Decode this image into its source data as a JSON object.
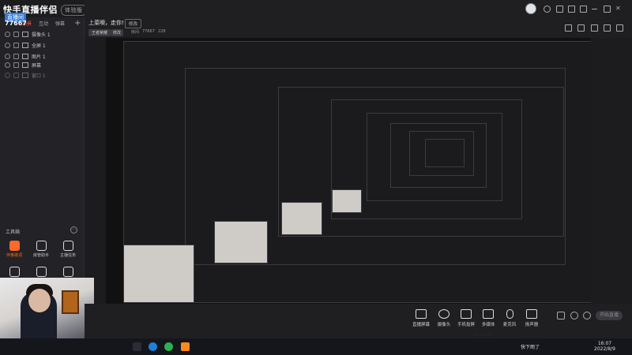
{
  "app": {
    "logo_text": "快手直播伴侣",
    "version_badge": "体验版",
    "biz_badge": "直播间",
    "room_number": "77667"
  },
  "scene_tabs": [
    "场景",
    "互动",
    "弹幕"
  ],
  "sources": [
    {
      "label": "摄像头 1"
    },
    {
      "label": "全屏 1"
    },
    {
      "label": "图片 1"
    },
    {
      "label": "屏幕"
    },
    {
      "label": "窗口 1"
    }
  ],
  "toolbox": {
    "title": "工具箱",
    "more": "···",
    "tools": [
      "伴奏歌词",
      "房管助手",
      "主播任务"
    ]
  },
  "header": {
    "live_title": "上菜噢，走你!",
    "edit_label": "修改",
    "category": "王者荣耀",
    "category_edit": "修改",
    "room_label": "房间",
    "room_id": "77667",
    "fans": "228"
  },
  "controls": [
    {
      "label": "直播屏幕",
      "icon": "screen-icon"
    },
    {
      "label": "摄像头",
      "icon": "camera-icon"
    },
    {
      "label": "手机投屏",
      "icon": "phone-icon"
    },
    {
      "label": "多媒体",
      "icon": "media-icon"
    },
    {
      "label": "麦克风",
      "icon": "mic-icon"
    },
    {
      "label": "扬声器",
      "icon": "speaker-icon"
    }
  ],
  "start_live_label": "开始直播",
  "taskbar": {
    "weather": "快下雨了",
    "time": "16:07",
    "date": "2022/8/9"
  },
  "colors": {
    "accent": "#ff5a4a",
    "orange": "#ff6a2b",
    "panel": "#232327",
    "bg": "#1c1c1f"
  }
}
